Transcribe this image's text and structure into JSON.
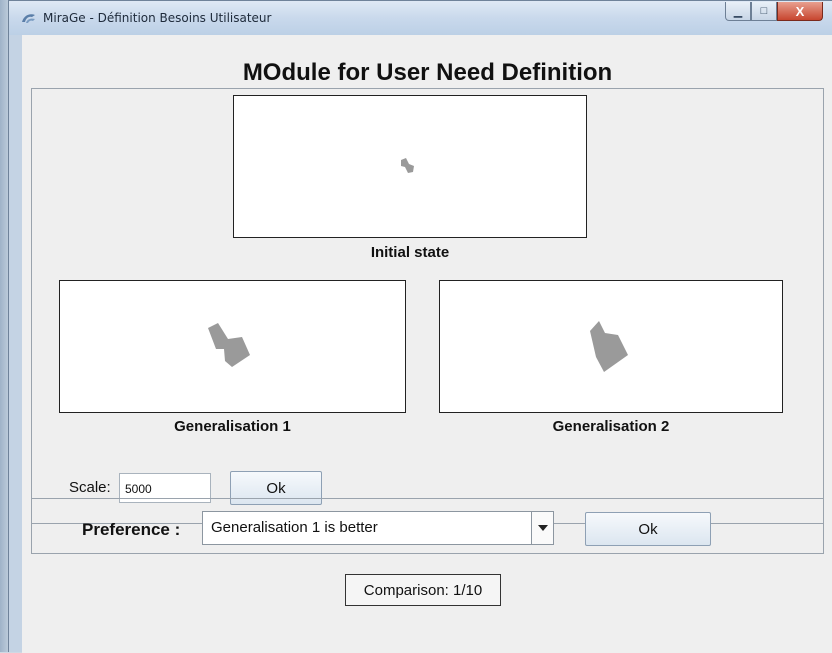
{
  "window": {
    "title": "MiraGe - Définition Besoins Utilisateur",
    "minimize_glyph": "▁",
    "maximize_glyph": "□",
    "close_glyph": "X",
    "app_icon": "mirage-app-icon"
  },
  "main": {
    "heading": "MOdule for User Need Definition",
    "initial": {
      "caption": "Initial state"
    },
    "gen1": {
      "caption": "Generalisation 1"
    },
    "gen2": {
      "caption": "Generalisation 2"
    },
    "scale": {
      "label": "Scale:",
      "value": "5000",
      "ok_label": "Ok"
    }
  },
  "preference": {
    "label": "Preference :",
    "selected": "Generalisation 1 is better",
    "ok_label": "Ok",
    "dropdown_icon": "chevron-down-icon"
  },
  "status": {
    "comparison": "Comparison: 1/10"
  },
  "colors": {
    "building_fill": "#9a9a9a",
    "window_bg": "#efefef",
    "accent": "#c7462f"
  }
}
